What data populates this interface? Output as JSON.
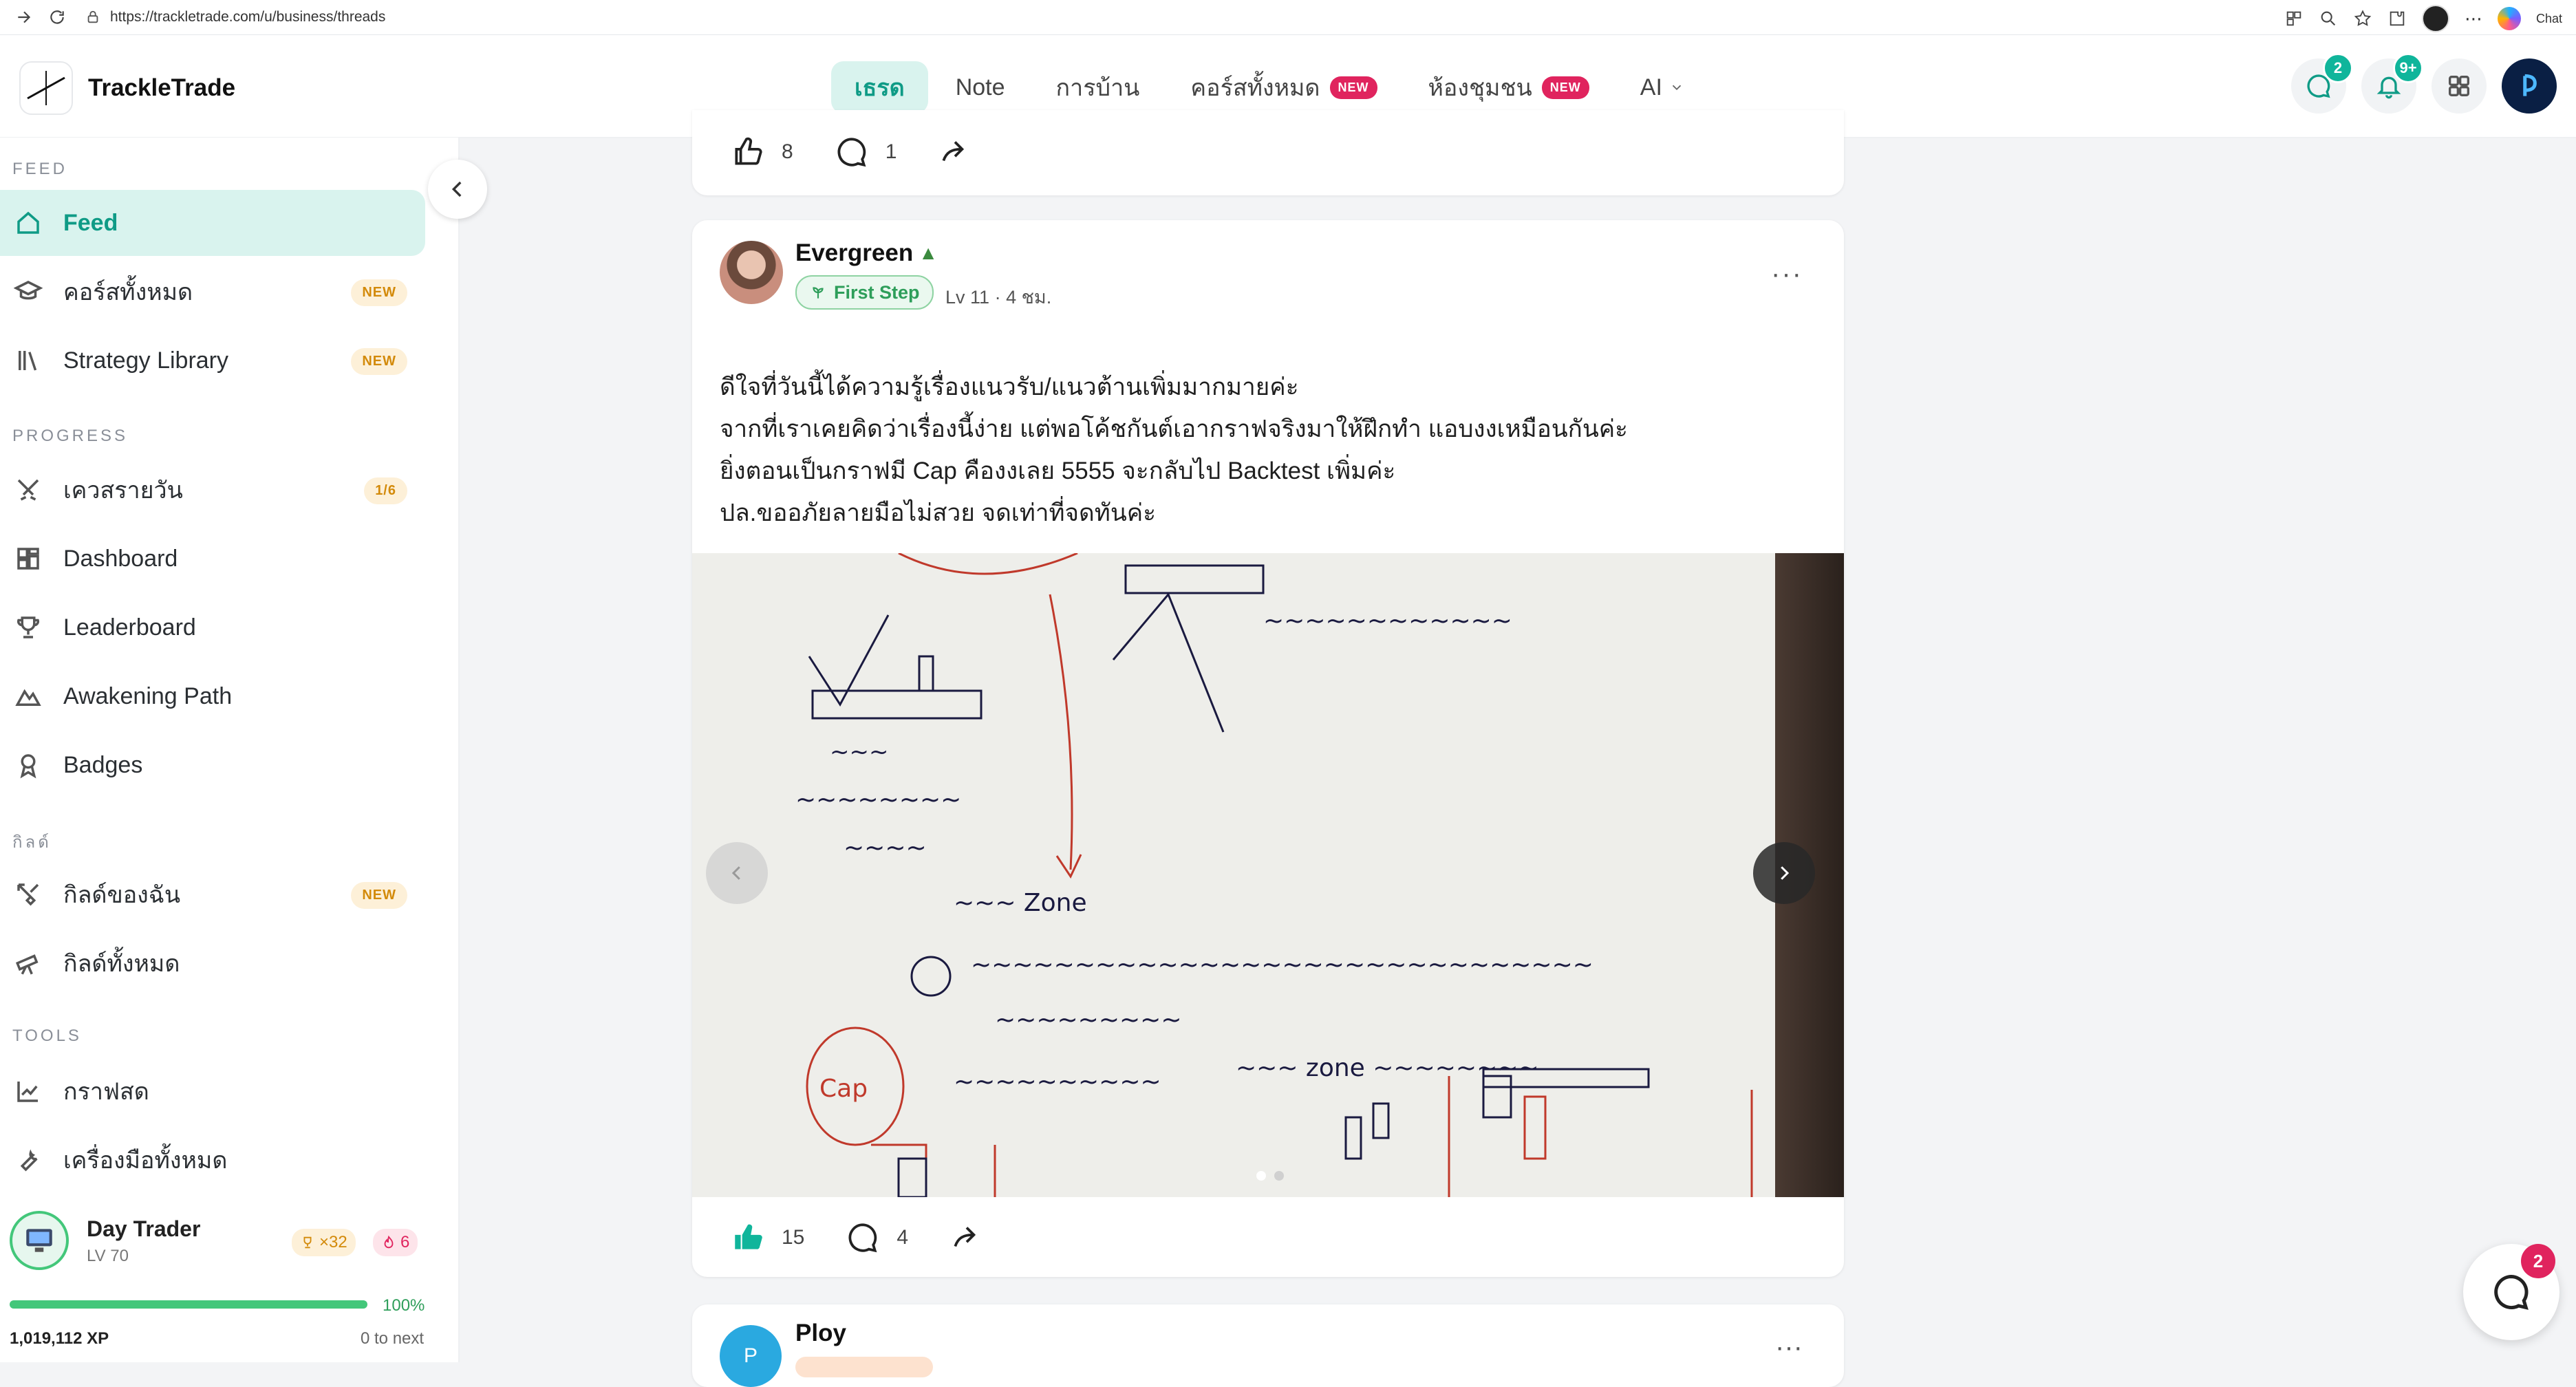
{
  "browser": {
    "url": "https://trackletrade.com/u/business/threads",
    "chat_label": "Chat"
  },
  "header": {
    "brand": "TrackleTrade",
    "tabs": [
      {
        "label": "เธรด",
        "active": true
      },
      {
        "label": "Note"
      },
      {
        "label": "การบ้าน"
      },
      {
        "label": "คอร์สทั้งหมด",
        "tag": "NEW"
      },
      {
        "label": "ห้องชุมชน",
        "tag": "NEW"
      },
      {
        "label": "AI"
      }
    ],
    "chat_badge": "2",
    "notif_badge": "9+"
  },
  "sidebar": {
    "sections": {
      "feed": "FEED",
      "progress": "PROGRESS",
      "guild": "กิลด์",
      "tools": "TOOLS"
    },
    "items": [
      {
        "label": "Feed",
        "icon": "home-icon",
        "active": true
      },
      {
        "label": "คอร์สทั้งหมด",
        "icon": "graduation-cap-icon",
        "tag": "NEW"
      },
      {
        "label": "Strategy Library",
        "icon": "library-icon",
        "tag": "NEW"
      },
      {
        "label": "เควสรายวัน",
        "icon": "swords-icon",
        "tag": "1/6"
      },
      {
        "label": "Dashboard",
        "icon": "dashboard-icon"
      },
      {
        "label": "Leaderboard",
        "icon": "trophy-icon"
      },
      {
        "label": "Awakening Path",
        "icon": "mountain-icon"
      },
      {
        "label": "Badges",
        "icon": "award-icon"
      },
      {
        "label": "กิลด์ของฉัน",
        "icon": "guild-icon",
        "tag": "NEW"
      },
      {
        "label": "กิลด์ทั้งหมด",
        "icon": "telescope-icon"
      },
      {
        "label": "กราฟสด",
        "icon": "chart-line-icon"
      },
      {
        "label": "เครื่องมือทั้งหมด",
        "icon": "wrench-icon"
      }
    ],
    "user": {
      "name": "Day Trader",
      "level": "LV 70",
      "trophies": "×32",
      "streak": "6",
      "xp_percent_label": "100%",
      "xp_fraction": 1.0,
      "xp_total": "1,019,112 XP",
      "xp_next": "0 to next"
    }
  },
  "feed": {
    "prev_post": {
      "likes": "8",
      "comments": "1"
    },
    "post": {
      "author": "Evergreen",
      "badge": "First Step",
      "level": "Lv 11",
      "time": "4 ชม.",
      "lines": [
        "ดีใจที่วันนี้ได้ความรู้เรื่องแนวรับ/แนวต้านเพิ่มมากมายค่ะ",
        "จากที่เราเคยคิดว่าเรื่องนี้ง่าย แต่พอโค้ชกันต์เอากราฟจริงมาให้ฝึกทำ แอบงงเหมือนกันค่ะ",
        "ยิ่งตอนเป็นกราฟมี Cap คืองงเลย 5555 จะกลับไป Backtest เพิ่มค่ะ",
        "ปล.ขออภัยลายมือไม่สวย จดเท่าที่จดทันค่ะ"
      ],
      "likes": "15",
      "comments": "4"
    },
    "next_post": {
      "author": "Ploy",
      "initial": "P"
    }
  },
  "chat_fab_badge": "2"
}
